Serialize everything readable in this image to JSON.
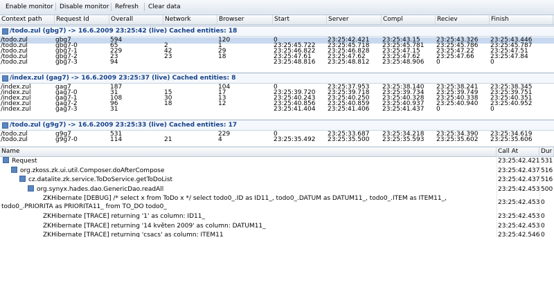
{
  "toolbar": {
    "enable": "Enable monitor",
    "disable": "Disable monitor",
    "refresh": "Refresh",
    "clear": "Clear data"
  },
  "columns": [
    "Context path",
    "Request Id",
    "Overall",
    "Network",
    "Browser",
    "Start",
    "Server",
    "Compl",
    "Reciev",
    "Finish"
  ],
  "groups": [
    {
      "header": "/todo.zul (gbg7) -> 16.6.2009 23:25:42 (live) Cached entities: 18",
      "rows": [
        [
          "/todo.zul",
          "gbg7",
          "594",
          "",
          "120",
          "0",
          "23:25:42.421",
          "23:25:43.15",
          "23:25:43.326",
          "23:25:43.446"
        ],
        [
          "/todo.zul",
          "gbg7-0",
          "65",
          "2",
          "1",
          "23:25:45.722",
          "23:25:45.718",
          "23:25:45.781",
          "23:25:45.786",
          "23:25:45.787"
        ],
        [
          "/todo.zul",
          "gbg7-1",
          "229",
          "42",
          "29",
          "23:25:46.822",
          "23:25:46.828",
          "23:25:47.15",
          "23:25:47.22",
          "23:25:47.51"
        ],
        [
          "/todo.zul",
          "gbg7-2",
          "23",
          "23",
          "18",
          "23:25:47.61",
          "23:25:47.62",
          "23:25:47.62",
          "23:25:47.66",
          "23:25:47.84"
        ],
        [
          "/todo.zul",
          "gbg7-3",
          "94",
          "",
          "",
          "23:25:48.816",
          "23:25:48.812",
          "23:25:48.906",
          "0",
          "0"
        ]
      ]
    },
    {
      "header": "/index.zul (gag7) -> 16.6.2009 23:25:37 (live) Cached entities: 8",
      "rows": [
        [
          "/index.zul",
          "gag7",
          "187",
          "",
          "104",
          "0",
          "23:25:37.953",
          "23:25:38.140",
          "23:25:38.241",
          "23:25:38.345"
        ],
        [
          "/index.zul",
          "gag7-0",
          "31",
          "15",
          "17",
          "23:25:39.720",
          "23:25:39.718",
          "23:25:39.734",
          "23:25:39.749",
          "23:25:39.751"
        ],
        [
          "/index.zul",
          "gag7-1",
          "108",
          "30",
          "13",
          "23:25:40.243",
          "23:25:40.250",
          "23:25:40.328",
          "23:25:40.338",
          "23:25:40.351"
        ],
        [
          "/index.zul",
          "gag7-2",
          "96",
          "18",
          "12",
          "23:25:40.856",
          "23:25:40.859",
          "23:25:40.937",
          "23:25:40.940",
          "23:25:40.952"
        ],
        [
          "/index.zul",
          "gag7-3",
          "31",
          "",
          "",
          "23:25:41.404",
          "23:25:41.406",
          "23:25:41.437",
          "0",
          "0"
        ]
      ]
    },
    {
      "header": "/todo.zul (g9g7) -> 16.6.2009 23:25:33 (live) Cached entities: 17",
      "rows": [
        [
          "/todo.zul",
          "g9g7",
          "531",
          "",
          "229",
          "0",
          "23:25:33.687",
          "23:25:34.218",
          "23:25:34.390",
          "23:25:34.619"
        ],
        [
          "/todo.zul",
          "g9g7-0",
          "114",
          "21",
          "4",
          "23:25:35.492",
          "23:25:35.500",
          "23:25:35.593",
          "23:25:35.602",
          "23:25:35.606"
        ]
      ]
    }
  ],
  "tree": {
    "columns": [
      "Name",
      "Call At",
      "Dur"
    ],
    "rows": [
      {
        "label": "Request",
        "indent": 0,
        "icon": true,
        "call": "23:25:42.421",
        "dur": "531"
      },
      {
        "label": "org.zkoss.zk.ui.util.Composer.doAfterCompose",
        "indent": 1,
        "icon": true,
        "call": "23:25:42.437",
        "dur": "516"
      },
      {
        "label": "cz.datalite.zk.service.ToDoService.getToDoList",
        "indent": 2,
        "icon": true,
        "call": "23:25:42.437",
        "dur": "516"
      },
      {
        "label": "org.synyx.hades.dao.GenericDao.readAll",
        "indent": 3,
        "icon": true,
        "call": "23:25:42.453",
        "dur": "500"
      },
      {
        "label": "ZKHibernate [DEBUG] /* select x from ToDo x */ select todo0_.ID as ID11_, todo0_.DATUM as DATUM11_, todo0_.ITEM as ITEM11_,",
        "label2": "todo0_.PRIORITA as PRIORITA11_ from TO_DO todo0_",
        "indent": 4,
        "icon": false,
        "call": "23:25:42.453",
        "dur": "0"
      },
      {
        "label": "ZKHibernate [TRACE] returning '1' as column: ID11_",
        "indent": 4,
        "icon": false,
        "call": "23:25:42.453",
        "dur": "0"
      },
      {
        "label": "ZKHibernate [TRACE] returning '14 květen 2009' as column: DATUM11_",
        "indent": 4,
        "icon": false,
        "call": "23:25:42.453",
        "dur": "0"
      },
      {
        "label": "ZKHibernate [TRACE] returning 'csacs' as column: ITEM11_",
        "indent": 4,
        "icon": false,
        "call": "23:25:42.546",
        "dur": "0"
      }
    ]
  }
}
